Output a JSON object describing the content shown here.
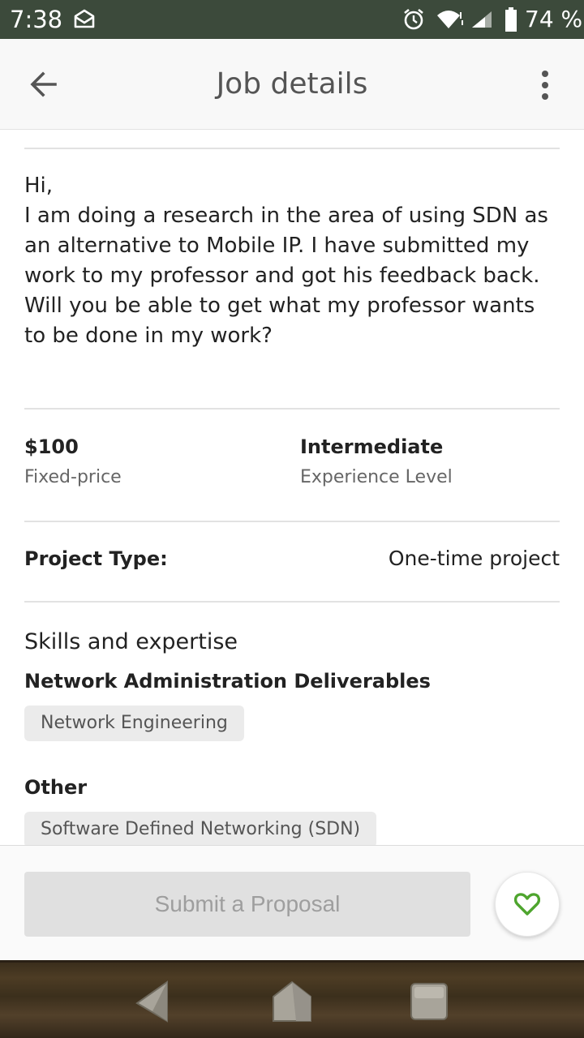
{
  "status_bar": {
    "time": "7:38",
    "battery": "74 %",
    "icons": [
      "mail-icon",
      "alarm-icon",
      "wifi-icon",
      "signal-icon",
      "battery-icon"
    ]
  },
  "app_bar": {
    "title": "Job details",
    "back_icon": "arrow-left-icon",
    "more_icon": "more-vertical-icon"
  },
  "job": {
    "description": "Hi,\nI am doing a research in the area of using SDN as an alternative to Mobile IP. I have submitted my work to my professor and got his feedback back.\nWill you be able to get what my professor wants to be done in my work?",
    "price": "$100",
    "price_type": "Fixed-price",
    "experience": "Intermediate",
    "experience_label": "Experience Level",
    "project_type_label": "Project Type:",
    "project_type_value": "One-time project"
  },
  "skills": {
    "title": "Skills and expertise",
    "groups": [
      {
        "title": "Network Administration Deliverables",
        "chips": [
          "Network Engineering"
        ]
      },
      {
        "title": "Other",
        "chips": [
          "Software Defined Networking (SDN)"
        ]
      }
    ]
  },
  "actions": {
    "submit_label": "Submit a Proposal",
    "favorite_icon": "heart-outline-icon",
    "favorite_color": "#4ea52e",
    "submit_bg": "#e0e0e0",
    "submit_text_color": "#9e9e9e"
  },
  "colors": {
    "status_bar": "#3c4a3b",
    "app_bar": "#f8f8f8"
  }
}
